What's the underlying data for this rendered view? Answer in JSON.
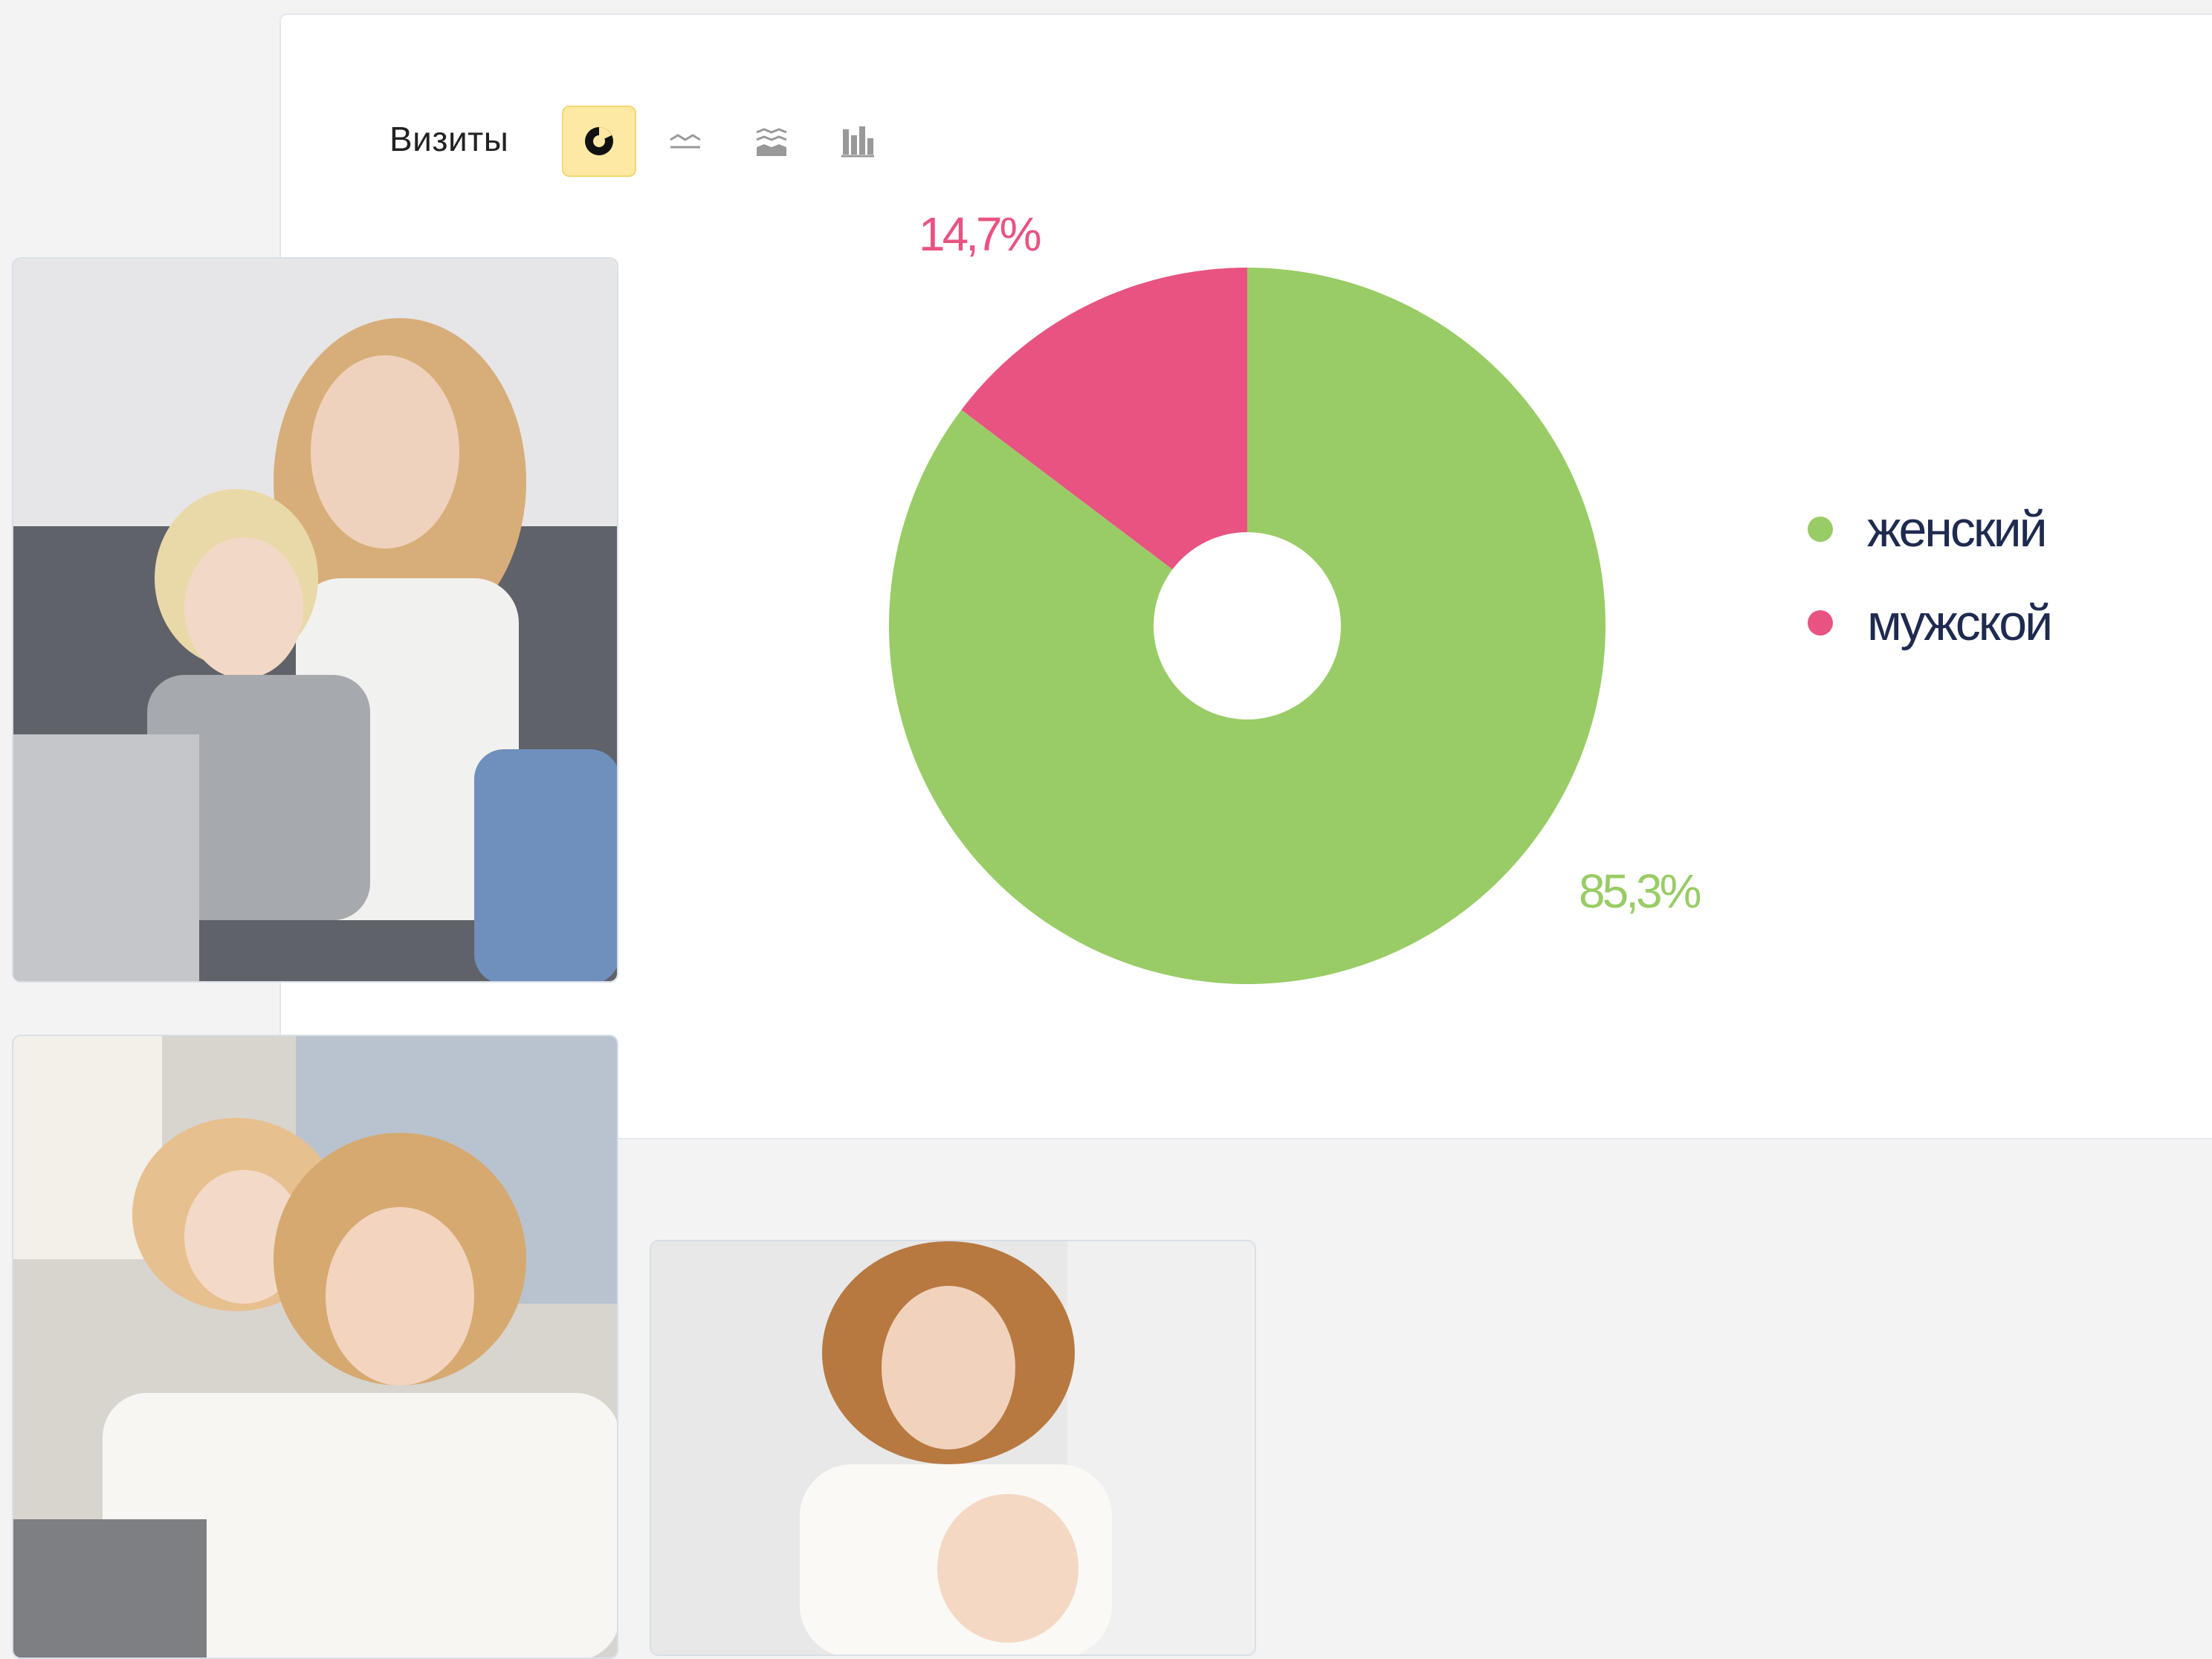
{
  "toolbar": {
    "title": "Визиты",
    "buttons": [
      {
        "name": "pie-chart-icon",
        "active": true
      },
      {
        "name": "line-chart-icon",
        "active": false
      },
      {
        "name": "area-chart-icon",
        "active": false
      },
      {
        "name": "bar-chart-icon",
        "active": false
      }
    ]
  },
  "chart_data": {
    "type": "pie",
    "donut": true,
    "categories": [
      "женский",
      "мужской"
    ],
    "values": [
      85.3,
      14.7
    ],
    "labels": [
      "85,3%",
      "14,7%"
    ],
    "colors": [
      "#99cc66",
      "#e85382"
    ],
    "legend_placement": "right"
  },
  "photos": [
    {
      "name": "photo-mother-son-laptop",
      "colors": [
        "#c8c8ca",
        "#6a6d72",
        "#d9b07a",
        "#8fa3bf"
      ]
    },
    {
      "name": "photo-mother-daughter-laptop",
      "colors": [
        "#d9d5cf",
        "#e9cfae",
        "#f4f0ea",
        "#b9c4d1"
      ]
    },
    {
      "name": "photo-mother-baby",
      "colors": [
        "#e4e4e4",
        "#f7f4ee",
        "#b87a44",
        "#f0d4bd"
      ]
    }
  ]
}
